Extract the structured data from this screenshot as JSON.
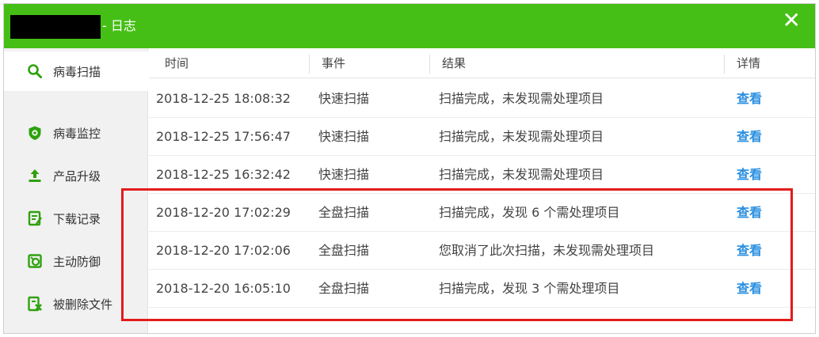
{
  "window": {
    "title": "- 日志",
    "close_glyph": "✕"
  },
  "sidebar": {
    "items": [
      {
        "label": "病毒扫描",
        "icon": "search-icon"
      },
      {
        "label": "病毒监控",
        "icon": "shield-icon"
      },
      {
        "label": "产品升级",
        "icon": "upload-icon"
      },
      {
        "label": "下载记录",
        "icon": "document-icon"
      },
      {
        "label": "主动防御",
        "icon": "defense-icon"
      },
      {
        "label": "被删除文件",
        "icon": "deleted-file-icon"
      }
    ],
    "active_index": 0
  },
  "table": {
    "headers": {
      "time": "时间",
      "event": "事件",
      "result": "结果",
      "detail": "详情"
    },
    "rows": [
      {
        "time": "2018-12-25 18:08:32",
        "event": "快速扫描",
        "result": "扫描完成，未发现需处理项目",
        "detail": "查看"
      },
      {
        "time": "2018-12-25 17:56:47",
        "event": "快速扫描",
        "result": "扫描完成，未发现需处理项目",
        "detail": "查看"
      },
      {
        "time": "2018-12-25 16:32:42",
        "event": "快速扫描",
        "result": "扫描完成，未发现需处理项目",
        "detail": "查看"
      },
      {
        "time": "2018-12-20 17:02:29",
        "event": "全盘扫描",
        "result": "扫描完成，发现 6 个需处理项目",
        "detail": "查看"
      },
      {
        "time": "2018-12-20 17:02:06",
        "event": "全盘扫描",
        "result": "您取消了此次扫描，未发现需处理项目",
        "detail": "查看"
      },
      {
        "time": "2018-12-20 16:05:10",
        "event": "全盘扫描",
        "result": "扫描完成，发现 3 个需处理项目",
        "detail": "查看"
      }
    ]
  },
  "colors": {
    "titlebar": "#45bf15",
    "icon_green": "#2fa10e",
    "link": "#2a8fe0",
    "highlight": "#e31b1b"
  }
}
